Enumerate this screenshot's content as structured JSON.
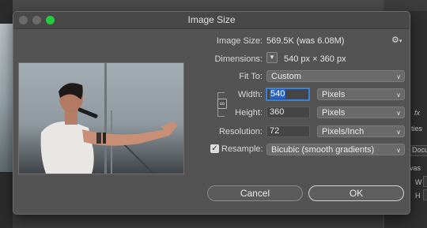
{
  "dialog": {
    "title": "Image Size",
    "gear_icon": "gear-icon"
  },
  "info": {
    "image_size_label": "Image Size:",
    "image_size_value": "569.5K (was 6.08M)",
    "dimensions_label": "Dimensions:",
    "dimensions_value": "540 px  ×  360 px"
  },
  "fit_to": {
    "label": "Fit To:",
    "value": "Custom"
  },
  "width": {
    "label": "Width:",
    "value": "540",
    "unit": "Pixels"
  },
  "height": {
    "label": "Height:",
    "value": "360",
    "unit": "Pixels"
  },
  "resolution": {
    "label": "Resolution:",
    "value": "72",
    "unit": "Pixels/Inch"
  },
  "resample": {
    "label": "Resample:",
    "checked": true,
    "value": "Bicubic (smooth gradients)"
  },
  "buttons": {
    "cancel": "Cancel",
    "ok": "OK"
  },
  "background": {
    "right_texts": [
      "fx",
      "ties",
      "Docum",
      "vas",
      "W",
      "H"
    ]
  },
  "colors": {
    "dialog_bg": "#535353",
    "accent_blue": "#3d80d8",
    "close_green": "#28c840"
  }
}
